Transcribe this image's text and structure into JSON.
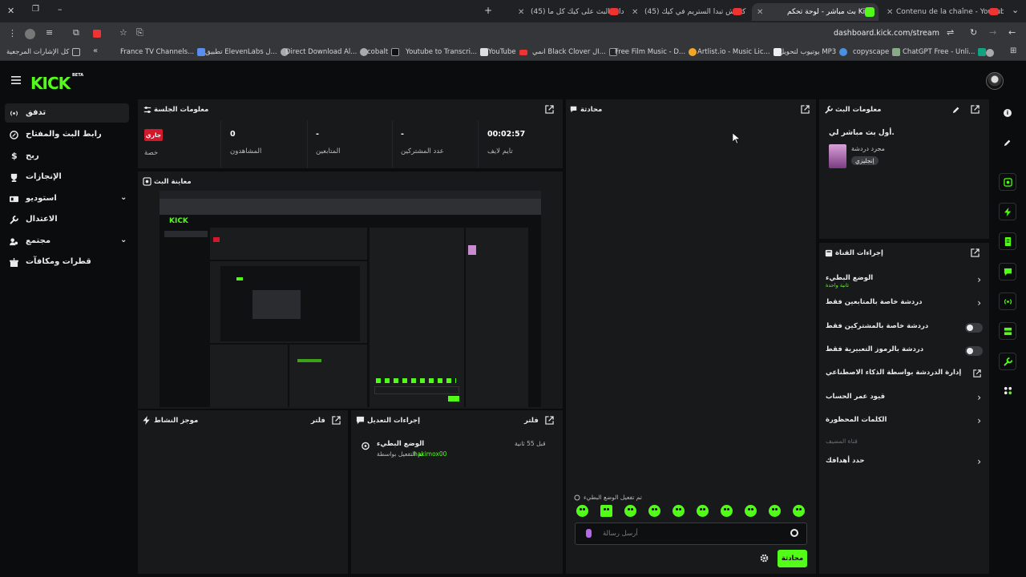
{
  "browser": {
    "tabs": [
      {
        "title": "Contenu de la chaîne - YouTube",
        "active": false
      },
      {
        "title": "بث مباشر - لوحة تحكم Kick",
        "active": true
      },
      {
        "title": "(45) كيفاش تبدا الستريم في كيك",
        "active": false
      },
      {
        "title": "(45) إعدادات البث على كيك كل ما",
        "active": false
      }
    ],
    "url": "dashboard.kick.com/stream",
    "bookmarks": [
      "ChatGPT Free - Unli...",
      "copyscape",
      "يوتيوب لتحويل MP3",
      "Artlist.io - Music Lic...",
      "Free Film Music - D...",
      "انمي Black Clover ال...",
      "YouTube",
      "Youtube to Transcri...",
      "cobalt",
      "Direct Download Al...",
      "تطبيق ElevenLabs ل...",
      "France TV Channels..."
    ],
    "all_bookmarks": "كل الإشارات المرجعية"
  },
  "app": {
    "logo": "KICK",
    "beta": "BETA"
  },
  "sidebar": {
    "items": [
      {
        "label": "تدفق",
        "icon": "broadcast-icon",
        "active": true
      },
      {
        "label": "رابط البث والمفتاح",
        "icon": "link-icon"
      },
      {
        "label": "ربح",
        "icon": "dollar-icon"
      },
      {
        "label": "الإنجازات",
        "icon": "trophy-icon"
      },
      {
        "label": "استوديو",
        "icon": "studio-icon",
        "expandable": true
      },
      {
        "label": "الاعتدال",
        "icon": "wrench-icon"
      },
      {
        "label": "مجتمع",
        "icon": "community-icon",
        "expandable": true
      },
      {
        "label": "قطرات ومكافآت",
        "icon": "gift-icon"
      }
    ]
  },
  "session": {
    "title": "معلومات الجلسة",
    "status_badge": "جاري",
    "status_label": "خصة",
    "viewers_value": "0",
    "viewers_label": "المشاهدون",
    "followers_value": "-",
    "followers_label": "المتابعين",
    "subs_value": "-",
    "subs_label": "عدد المشتركين",
    "time_value": "00:02:57",
    "time_label": "تايم لايف"
  },
  "preview": {
    "title": "معاينة البث"
  },
  "activity": {
    "title": "موجز النشاط",
    "filter": "فلتر"
  },
  "mod_actions": {
    "title": "إجراءات التعديل",
    "filter": "فلتر",
    "entry_title": "الوضع البطيء",
    "entry_time": "قبل 55 ثانية",
    "entry_by": "تم التفعيل بواسطة",
    "entry_user": "hakimox00"
  },
  "chat": {
    "title": "محادثة",
    "system_msg": "تم تفعيل الوضع البطيء",
    "placeholder": "أرسل رسالة",
    "send": "محادثة"
  },
  "stream_info": {
    "title": "معلومات البث",
    "stream_title": "أول بث مباشر لي.",
    "category": "مجرد دردشة",
    "tag": "إنجليزي"
  },
  "channel_actions": {
    "title": "إجراءات القناة",
    "items": [
      {
        "label": "الوضع البطيء",
        "sub": "ثانية واحدة",
        "control": "chevron"
      },
      {
        "label": "دردشة خاصة بالمتابعين فقط",
        "control": "chevron"
      },
      {
        "label": "دردشة خاصة بالمشتركين فقط",
        "control": "toggle"
      },
      {
        "label": "دردشة بالرموز التعبيرية فقط",
        "control": "toggle"
      },
      {
        "label": "إدارة الدردشة بواسطة الذكاء الاصطناعي",
        "control": "external"
      },
      {
        "label": "قيود عمر الحساب",
        "control": "chevron"
      },
      {
        "label": "الكلمات المحظورة",
        "control": "chevron"
      }
    ],
    "host_label": "قناة المضيف",
    "goal_label": "حدد أهدافك"
  },
  "colors": {
    "accent": "#53fc18",
    "live": "#d2182b",
    "panel": "#18191b",
    "background": "#0b0c0d"
  }
}
